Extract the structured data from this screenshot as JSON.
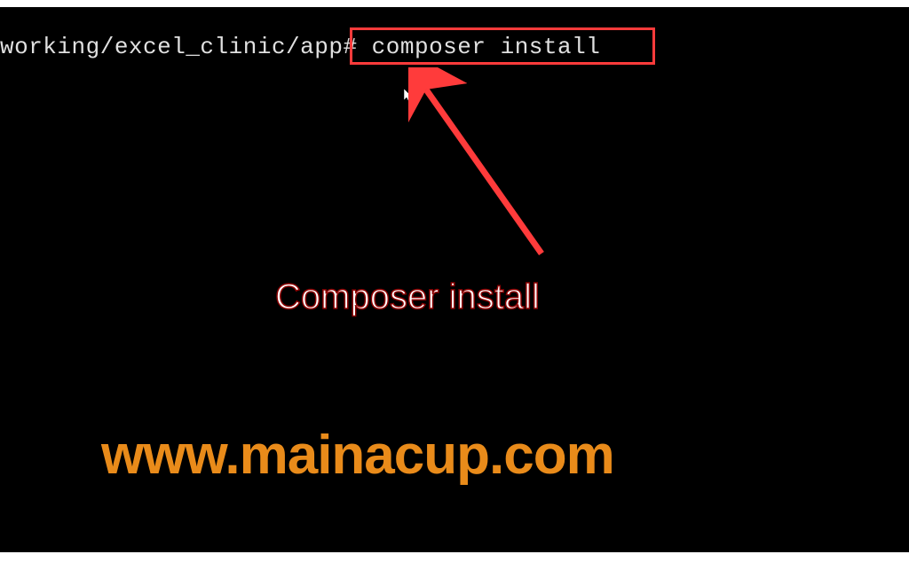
{
  "terminal": {
    "prompt_text": "working/excel_clinic/app# composer install",
    "highlighted_command": "composer install"
  },
  "annotation": {
    "caption": "Composer install",
    "cursor_glyph": "↖"
  },
  "watermark": {
    "text": "www.mainacup.com"
  },
  "colors": {
    "terminal_bg": "#000000",
    "terminal_fg": "#e0e0e0",
    "highlight_border": "#ff3b3b",
    "arrow_fill": "#ff3b3b",
    "caption_fill": "#ffffff",
    "caption_stroke": "#8b0000",
    "watermark_color": "#e98b1a"
  }
}
